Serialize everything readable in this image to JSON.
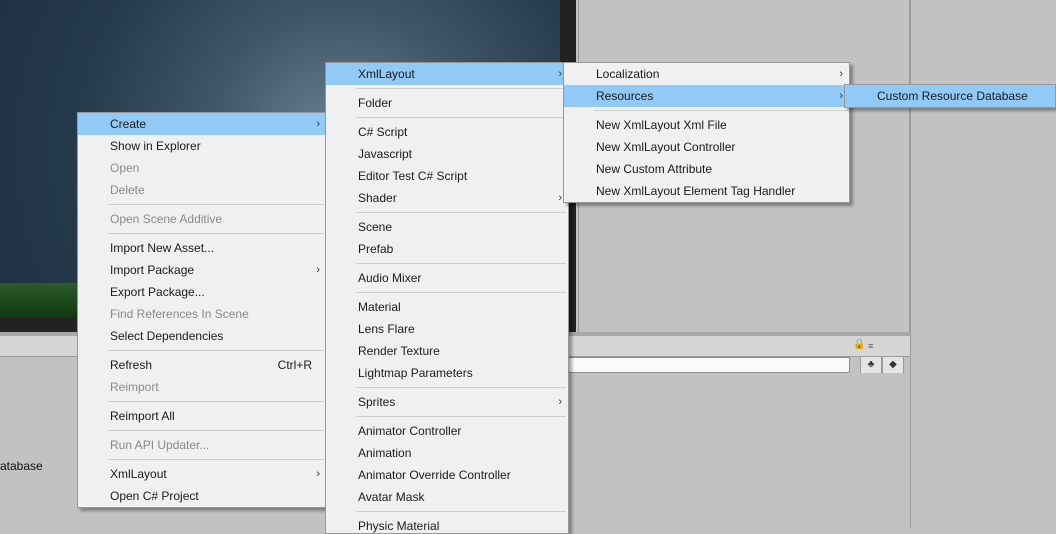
{
  "background": {
    "asset_label": "atabase"
  },
  "icons": {
    "lock": "lock-icon",
    "menu": "menu-lines-icon"
  },
  "menu_main": {
    "items": [
      {
        "label": "Create",
        "state": "highlight",
        "submenu": true
      },
      {
        "label": "Show in Explorer"
      },
      {
        "label": "Open",
        "state": "disabled"
      },
      {
        "label": "Delete",
        "state": "disabled"
      },
      {
        "sep": true
      },
      {
        "label": "Open Scene Additive",
        "state": "disabled"
      },
      {
        "sep": true
      },
      {
        "label": "Import New Asset..."
      },
      {
        "label": "Import Package",
        "submenu": true
      },
      {
        "label": "Export Package..."
      },
      {
        "label": "Find References In Scene",
        "state": "disabled"
      },
      {
        "label": "Select Dependencies"
      },
      {
        "sep": true
      },
      {
        "label": "Refresh",
        "shortcut": "Ctrl+R"
      },
      {
        "label": "Reimport",
        "state": "disabled"
      },
      {
        "sep": true
      },
      {
        "label": "Reimport All"
      },
      {
        "sep": true
      },
      {
        "label": "Run API Updater...",
        "state": "disabled"
      },
      {
        "sep": true
      },
      {
        "label": "XmlLayout",
        "submenu": true
      },
      {
        "label": "Open C# Project"
      }
    ]
  },
  "menu_create": {
    "items": [
      {
        "label": "XmlLayout",
        "state": "highlight",
        "submenu": true
      },
      {
        "sep": true
      },
      {
        "label": "Folder"
      },
      {
        "sep": true
      },
      {
        "label": "C# Script"
      },
      {
        "label": "Javascript"
      },
      {
        "label": "Editor Test C# Script"
      },
      {
        "label": "Shader",
        "submenu": true
      },
      {
        "sep": true
      },
      {
        "label": "Scene"
      },
      {
        "label": "Prefab"
      },
      {
        "sep": true
      },
      {
        "label": "Audio Mixer"
      },
      {
        "sep": true
      },
      {
        "label": "Material"
      },
      {
        "label": "Lens Flare"
      },
      {
        "label": "Render Texture"
      },
      {
        "label": "Lightmap Parameters"
      },
      {
        "sep": true
      },
      {
        "label": "Sprites",
        "submenu": true
      },
      {
        "sep": true
      },
      {
        "label": "Animator Controller"
      },
      {
        "label": "Animation"
      },
      {
        "label": "Animator Override Controller"
      },
      {
        "label": "Avatar Mask"
      },
      {
        "sep": true
      },
      {
        "label": "Physic Material"
      }
    ]
  },
  "menu_xmllayout": {
    "items": [
      {
        "label": "Localization",
        "submenu": true
      },
      {
        "label": "Resources",
        "state": "highlight",
        "submenu": true
      },
      {
        "sep": true
      },
      {
        "label": "New XmlLayout Xml File"
      },
      {
        "label": "New XmlLayout Controller"
      },
      {
        "label": "New Custom Attribute"
      },
      {
        "label": "New XmlLayout Element Tag Handler"
      }
    ]
  },
  "menu_resources": {
    "items": [
      {
        "label": "Custom Resource Database",
        "state": "highlight"
      }
    ]
  },
  "submenu_arrow": "›"
}
